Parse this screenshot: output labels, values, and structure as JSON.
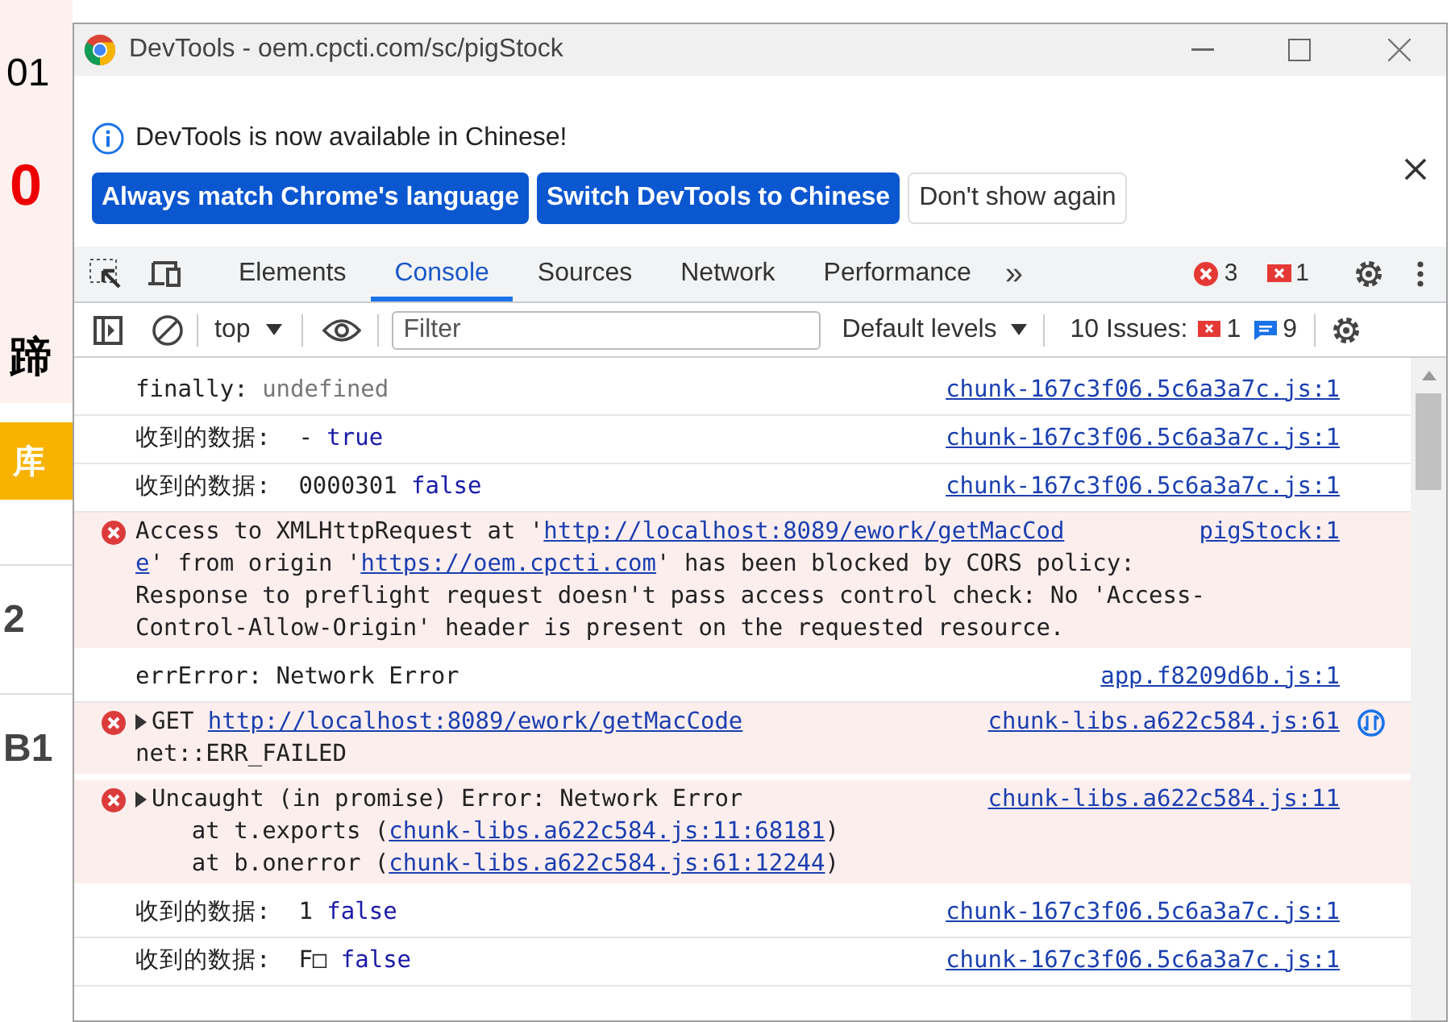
{
  "background_page": {
    "texts": [
      {
        "kind": "number",
        "text": "01"
      },
      {
        "kind": "red",
        "text": "0"
      },
      {
        "kind": "bold",
        "text": "蹄"
      },
      {
        "kind": "button",
        "text": "库"
      },
      {
        "kind": "gray",
        "text": "2"
      },
      {
        "kind": "gray",
        "text": "B1"
      }
    ]
  },
  "window": {
    "title": "DevTools - oem.cpcti.com/sc/pigStock"
  },
  "infobar": {
    "message": "DevTools is now available in Chinese!",
    "buttons": [
      {
        "label": "Always match Chrome's language",
        "kind": "primary"
      },
      {
        "label": "Switch DevTools to Chinese",
        "kind": "primary"
      },
      {
        "label": "Don't show again",
        "kind": "secondary"
      }
    ]
  },
  "tabs": [
    {
      "label": "Elements",
      "selected": false
    },
    {
      "label": "Console",
      "selected": true
    },
    {
      "label": "Sources",
      "selected": false
    },
    {
      "label": "Network",
      "selected": false
    },
    {
      "label": "Performance",
      "selected": false
    }
  ],
  "more_tabs": "»",
  "counters": {
    "errors": "3",
    "issues": "1"
  },
  "toolbar": {
    "context": "top",
    "filter_placeholder": "Filter",
    "levels": "Default levels",
    "issues_label": "10 Issues:",
    "issues_errors": "1",
    "issues_info": "9"
  },
  "messages": [
    {
      "kind": "log",
      "expandable": false,
      "source": "chunk-167c3f06.5c6a3a7c.js:1",
      "lines": [
        [
          {
            "kind": "plain",
            "text": "finally: "
          },
          {
            "kind": "muted",
            "text": "undefined"
          }
        ]
      ]
    },
    {
      "kind": "log",
      "expandable": false,
      "source": "chunk-167c3f06.5c6a3a7c.js:1",
      "lines": [
        [
          {
            "kind": "plain",
            "text": "收到的数据:  - "
          },
          {
            "kind": "value",
            "text": "true"
          }
        ]
      ]
    },
    {
      "kind": "log",
      "expandable": false,
      "source": "chunk-167c3f06.5c6a3a7c.js:1",
      "lines": [
        [
          {
            "kind": "plain",
            "text": "收到的数据:  0000301 "
          },
          {
            "kind": "value",
            "text": "false"
          }
        ]
      ]
    },
    {
      "kind": "error",
      "expandable": false,
      "source": "pigStock:1",
      "lines": [
        [
          {
            "kind": "plain",
            "text": "Access to XMLHttpRequest at '"
          },
          {
            "kind": "link",
            "text": "http://localhost:8089/ework/getMacCod"
          }
        ],
        [
          {
            "kind": "link",
            "text": "e"
          },
          {
            "kind": "plain",
            "text": "' from origin '"
          },
          {
            "kind": "link",
            "text": "https://oem.cpcti.com"
          },
          {
            "kind": "plain",
            "text": "' has been blocked by CORS policy:"
          }
        ],
        [
          {
            "kind": "plain",
            "text": "Response to preflight request doesn't pass access control check: No 'Access-"
          }
        ],
        [
          {
            "kind": "plain",
            "text": "Control-Allow-Origin' header is present on the requested resource."
          }
        ]
      ]
    },
    {
      "kind": "log",
      "expandable": false,
      "source": "app.f8209d6b.js:1",
      "lines": [
        [
          {
            "kind": "plain",
            "text": "errError: Network Error"
          }
        ]
      ]
    },
    {
      "kind": "error",
      "expandable": true,
      "network": true,
      "source": "chunk-libs.a622c584.js:61",
      "lines": [
        [
          {
            "kind": "plain",
            "text": "GET "
          },
          {
            "kind": "link",
            "text": "http://localhost:8089/ework/getMacCode"
          }
        ],
        [
          {
            "kind": "plain",
            "text": "net::ERR_FAILED"
          }
        ]
      ]
    },
    {
      "kind": "error",
      "expandable": true,
      "source": "chunk-libs.a622c584.js:11",
      "lines": [
        [
          {
            "kind": "plain",
            "text": "Uncaught (in promise) Error: Network Error"
          }
        ],
        [
          {
            "kind": "plain",
            "text": "    at t.exports ("
          },
          {
            "kind": "link",
            "text": "chunk-libs.a622c584.js:11:68181"
          },
          {
            "kind": "plain",
            "text": ")"
          }
        ],
        [
          {
            "kind": "plain",
            "text": "    at b.onerror ("
          },
          {
            "kind": "link",
            "text": "chunk-libs.a622c584.js:61:12244"
          },
          {
            "kind": "plain",
            "text": ")"
          }
        ]
      ]
    },
    {
      "kind": "log",
      "expandable": false,
      "source": "chunk-167c3f06.5c6a3a7c.js:1",
      "lines": [
        [
          {
            "kind": "plain",
            "text": "收到的数据:  1 "
          },
          {
            "kind": "value",
            "text": "false"
          }
        ]
      ]
    },
    {
      "kind": "log",
      "expandable": false,
      "source": "chunk-167c3f06.5c6a3a7c.js:1",
      "lines": [
        [
          {
            "kind": "plain",
            "text": "收到的数据:  F□ "
          },
          {
            "kind": "value",
            "text": "false"
          }
        ]
      ]
    }
  ]
}
